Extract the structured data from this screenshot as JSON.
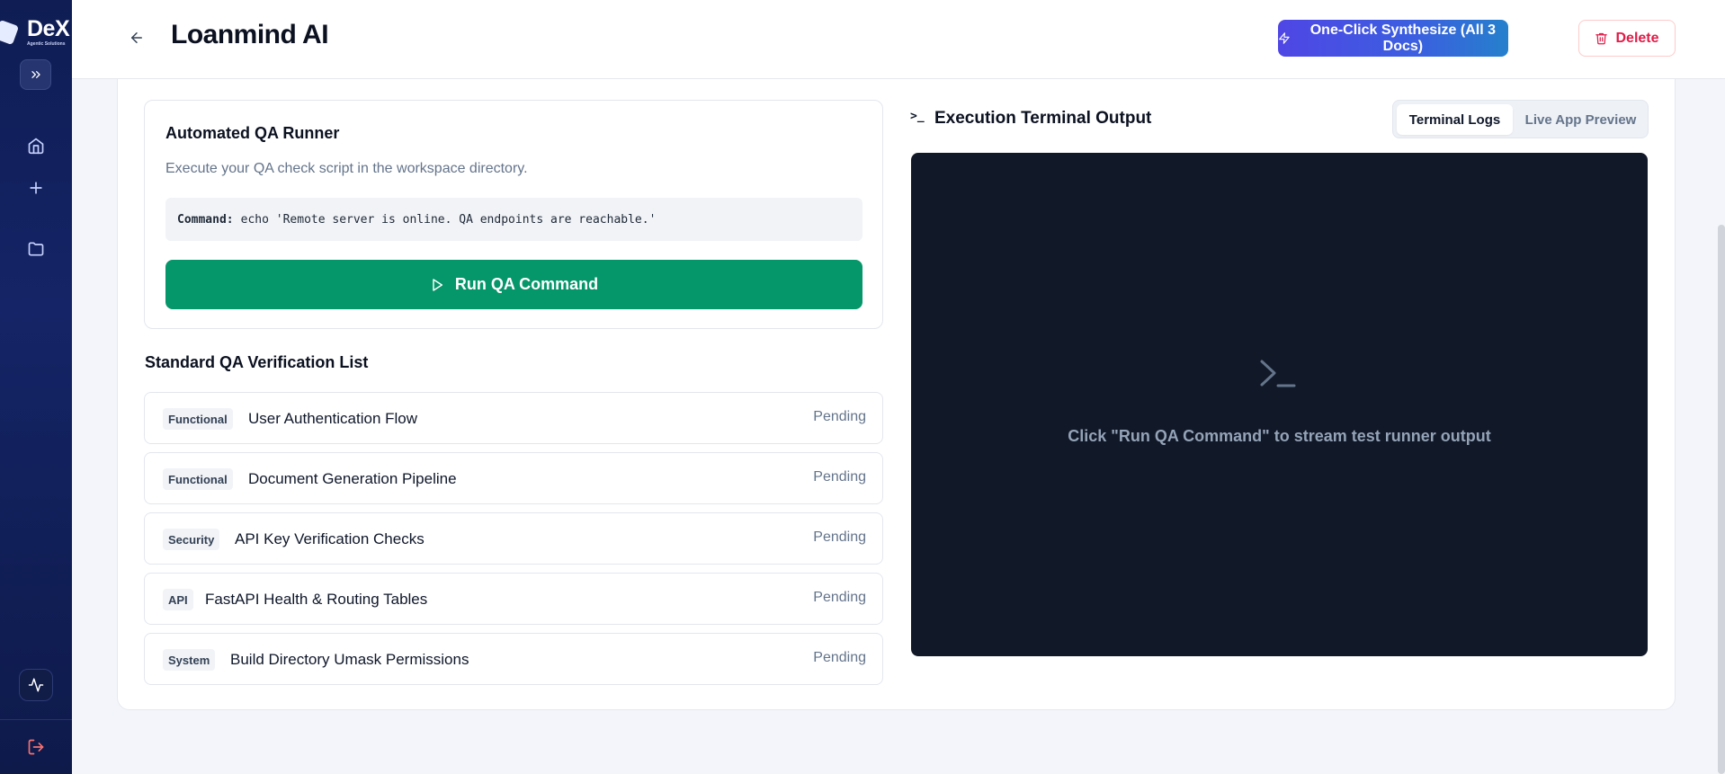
{
  "sidebar": {
    "logo_text": "DeX",
    "logo_sub": "Agentic Solutions",
    "icons": [
      "chevrons-right-icon",
      "home-icon",
      "plus-icon",
      "folder-icon",
      "activity-icon",
      "logout-icon"
    ]
  },
  "header": {
    "title": "Loanmind AI",
    "synth_label": "One-Click Synthesize (All 3 Docs)",
    "delete_label": "Delete"
  },
  "qa_runner": {
    "title": "Automated QA Runner",
    "description": "Execute your QA check script in the workspace directory.",
    "command_label": "Command:",
    "command_value": "echo 'Remote server is online. QA endpoints are reachable.'",
    "run_label": "Run QA Command"
  },
  "verification": {
    "title": "Standard QA Verification List",
    "items": [
      {
        "badge": "Functional",
        "label": "User Authentication Flow",
        "status": "Pending"
      },
      {
        "badge": "Functional",
        "label": "Document Generation Pipeline",
        "status": "Pending"
      },
      {
        "badge": "Security",
        "label": "API Key Verification Checks",
        "status": "Pending"
      },
      {
        "badge": "API",
        "label": "FastAPI Health & Routing Tables",
        "status": "Pending"
      },
      {
        "badge": "System",
        "label": "Build Directory Umask Permissions",
        "status": "Pending"
      }
    ]
  },
  "terminal": {
    "title": "Execution Terminal Output",
    "tabs": [
      "Terminal Logs",
      "Live App Preview"
    ],
    "placeholder": "Click \"Run QA Command\" to stream test runner output"
  },
  "colors": {
    "sidebar": "#0f1d54",
    "run_button": "#059669",
    "delete": "#e11d48",
    "terminal_bg": "#111827"
  }
}
